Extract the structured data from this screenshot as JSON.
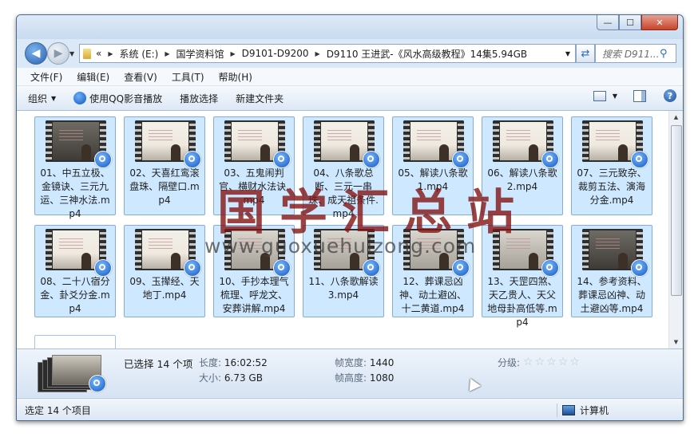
{
  "window": {
    "controls": {
      "minimize": "—",
      "maximize": "☐",
      "close": "✕"
    }
  },
  "nav": {
    "back_icon": "left-arrow-icon",
    "forward_icon": "right-arrow-icon",
    "address": {
      "overflow": "«",
      "crumbs": [
        "系统 (E:)",
        "国学资料馆",
        "D9101-D9200",
        "D9110 王进武-《风水高级教程》14集5.94GB"
      ]
    },
    "search_placeholder": "搜索 D911..."
  },
  "menu": [
    "文件(F)",
    "编辑(E)",
    "查看(V)",
    "工具(T)",
    "帮助(H)"
  ],
  "toolbar": {
    "organize": "组织",
    "play_qq": "使用QQ影音播放",
    "play_selection": "播放选择",
    "new_folder": "新建文件夹"
  },
  "files": [
    {
      "name": "01、中五立极、金镜诀、三元九运、三神水法.mp4",
      "scene": "dark"
    },
    {
      "name": "02、天喜红鸾滚盘珠、隔壁口.mp4",
      "scene": "bright"
    },
    {
      "name": "03、五鬼闹判官、横财水法诀.mp4",
      "scene": "bright"
    },
    {
      "name": "04、八条歌总断、三元一串珠、成天祖条件.mp4",
      "scene": "bright"
    },
    {
      "name": "05、解读八条歌1.mp4",
      "scene": "bright"
    },
    {
      "name": "06、解读八条歌2.mp4",
      "scene": "bright"
    },
    {
      "name": "07、三元致杂、裁剪五法、演海分金.mp4",
      "scene": "bright"
    },
    {
      "name": "08、二十八宿分金、卦爻分金.mp4",
      "scene": "bright"
    },
    {
      "name": "09、玉撵经、天地丁.mp4",
      "scene": "bright"
    },
    {
      "name": "10、手抄本理气梳理、呼龙文、安葬讲解.mp4",
      "scene": "board"
    },
    {
      "name": "11、八条歌解读3.mp4",
      "scene": "board"
    },
    {
      "name": "12、葬课忌凶神、动土避凶、十二黄道.mp4",
      "scene": "board"
    },
    {
      "name": "13、天罡四煞、天乙贵人、天父地母卦高低等.mp4",
      "scene": "board"
    },
    {
      "name": "14、参考资料、葬课忌凶神、动土避凶等.mp4",
      "scene": "dark"
    }
  ],
  "details": {
    "selected": "已选择 14 个项",
    "length_label": "长度:",
    "length": "16:02:52",
    "size_label": "大小:",
    "size": "6.73 GB",
    "frame_width_label": "帧宽度:",
    "frame_width": "1440",
    "frame_height_label": "帧高度:",
    "frame_height": "1080",
    "rating_label": "分级:",
    "rating": 0
  },
  "status": {
    "left": "选定 14 个项目",
    "right": "计算机"
  },
  "watermark": {
    "cn": "国学汇总站",
    "url": "www.guoxuehuizong.com"
  }
}
